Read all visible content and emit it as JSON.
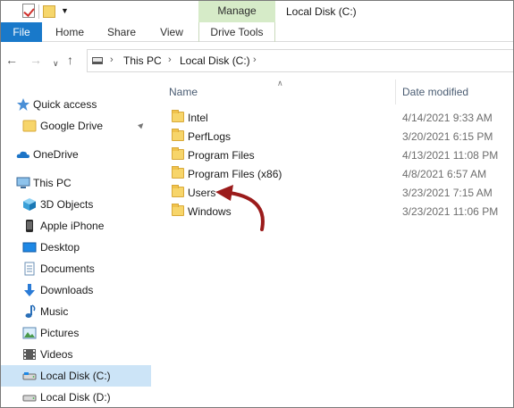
{
  "window": {
    "title": "Local Disk (C:)"
  },
  "contextual_tab": {
    "group_label": "Manage"
  },
  "ribbon": {
    "tabs": [
      {
        "label": "File"
      },
      {
        "label": "Home"
      },
      {
        "label": "Share"
      },
      {
        "label": "View"
      },
      {
        "label": "Drive Tools"
      }
    ]
  },
  "address": {
    "segments": [
      "This PC",
      "Local Disk (C:)"
    ]
  },
  "nav_pane": {
    "items": [
      {
        "label": "Quick access",
        "icon": "star-icon"
      },
      {
        "label": "Google Drive",
        "icon": "folder-icon",
        "pinned": true
      },
      {
        "label": "OneDrive",
        "icon": "cloud-icon"
      },
      {
        "label": "This PC",
        "icon": "computer-icon"
      },
      {
        "label": "3D Objects",
        "icon": "cube-icon"
      },
      {
        "label": "Apple iPhone",
        "icon": "phone-icon"
      },
      {
        "label": "Desktop",
        "icon": "desktop-icon"
      },
      {
        "label": "Documents",
        "icon": "document-icon"
      },
      {
        "label": "Downloads",
        "icon": "download-icon"
      },
      {
        "label": "Music",
        "icon": "music-icon"
      },
      {
        "label": "Pictures",
        "icon": "picture-icon"
      },
      {
        "label": "Videos",
        "icon": "video-icon"
      },
      {
        "label": "Local Disk (C:)",
        "icon": "drive-icon",
        "selected": true
      },
      {
        "label": "Local Disk (D:)",
        "icon": "drive-icon"
      }
    ]
  },
  "file_list": {
    "columns": {
      "name": "Name",
      "date_modified": "Date modified"
    },
    "rows": [
      {
        "name": "Intel",
        "date_modified": "4/14/2021 9:33 AM"
      },
      {
        "name": "PerfLogs",
        "date_modified": "3/20/2021 6:15 PM"
      },
      {
        "name": "Program Files",
        "date_modified": "4/13/2021 11:08 PM"
      },
      {
        "name": "Program Files (x86)",
        "date_modified": "4/8/2021 6:57 AM"
      },
      {
        "name": "Users",
        "date_modified": "3/23/2021 7:15 AM"
      },
      {
        "name": "Windows",
        "date_modified": "3/23/2021 11:06 PM"
      }
    ]
  },
  "colors": {
    "file_tab": "#1979ca",
    "contextual_band": "#d6ebc8",
    "selection": "#cce4f7",
    "annotation_arrow": "#9b1b1b"
  }
}
